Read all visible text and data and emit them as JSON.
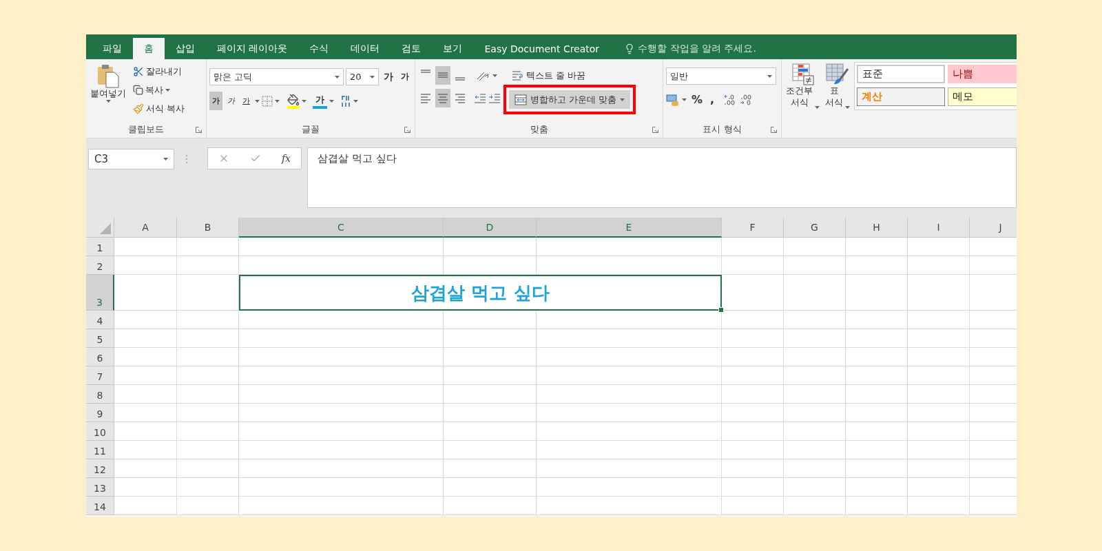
{
  "tabs": [
    {
      "label": "파일",
      "selected": false
    },
    {
      "label": "홈",
      "selected": true
    },
    {
      "label": "삽입",
      "selected": false
    },
    {
      "label": "페이지 레이아웃",
      "selected": false
    },
    {
      "label": "수식",
      "selected": false
    },
    {
      "label": "데이터",
      "selected": false
    },
    {
      "label": "검토",
      "selected": false
    },
    {
      "label": "보기",
      "selected": false
    },
    {
      "label": "Easy Document Creator",
      "selected": false
    }
  ],
  "tell_me": {
    "placeholder": "수행할 작업을 알려 주세요."
  },
  "clipboard": {
    "title": "클립보드",
    "paste": "붙여넣기",
    "cut": "잘라내기",
    "copy": "복사",
    "format_painter": "서식 복사"
  },
  "font": {
    "title": "글꼴",
    "font_name": "맑은 고딕",
    "font_size": "20",
    "grow": "가",
    "shrink": "가",
    "styles": [
      {
        "kind": "bold",
        "label": "가",
        "selected": true
      },
      {
        "kind": "italic",
        "label": "가",
        "selected": false
      },
      {
        "kind": "underline",
        "label": "가",
        "selected": false
      }
    ],
    "font_color": "가"
  },
  "alignment": {
    "title": "맞춤",
    "vertical": [
      {
        "kind": "top",
        "selected": false
      },
      {
        "kind": "middle",
        "selected": true
      },
      {
        "kind": "bottom",
        "selected": false
      }
    ],
    "horizontal": [
      {
        "kind": "left",
        "selected": false
      },
      {
        "kind": "center",
        "selected": true
      },
      {
        "kind": "right",
        "selected": false
      }
    ],
    "wrap_text": "텍스트 줄 바꿈",
    "merge": {
      "label": "병합하고 가운데 맞춤",
      "highlighted": true
    }
  },
  "number": {
    "title": "표시 형식",
    "format": "일반",
    "percent": "%",
    "comma": ","
  },
  "styles": {
    "conditional_formatting": "조건부\n서식",
    "format_as_table": "표\n서식",
    "cell_styles": [
      {
        "kind": "normal",
        "label": "표준"
      },
      {
        "kind": "bad",
        "label": "나쁨"
      },
      {
        "kind": "calculation",
        "label": "계산"
      },
      {
        "kind": "note",
        "label": "메모"
      }
    ]
  },
  "formula_bar": {
    "name_box": "C3",
    "function_label": "fx",
    "value": "삼겹살 먹고 싶다"
  },
  "sheet": {
    "columns": [
      {
        "label": "A",
        "selected": false
      },
      {
        "label": "B",
        "selected": false
      },
      {
        "label": "C",
        "selected": true
      },
      {
        "label": "D",
        "selected": true
      },
      {
        "label": "E",
        "selected": true
      },
      {
        "label": "F",
        "selected": false
      },
      {
        "label": "G",
        "selected": false
      },
      {
        "label": "H",
        "selected": false
      },
      {
        "label": "I",
        "selected": false
      },
      {
        "label": "J",
        "selected": false
      }
    ],
    "rows": [
      {
        "label": "1",
        "selected": false
      },
      {
        "label": "2",
        "selected": false
      },
      {
        "label": "3",
        "selected": true
      },
      {
        "label": "4",
        "selected": false
      },
      {
        "label": "5",
        "selected": false
      },
      {
        "label": "6",
        "selected": false
      },
      {
        "label": "7",
        "selected": false
      },
      {
        "label": "8",
        "selected": false
      },
      {
        "label": "9",
        "selected": false
      },
      {
        "label": "10",
        "selected": false
      },
      {
        "label": "11",
        "selected": false
      },
      {
        "label": "12",
        "selected": false
      },
      {
        "label": "13",
        "selected": false
      },
      {
        "label": "14",
        "selected": false
      }
    ],
    "active_cell": {
      "text": "삼겹살 먹고 싶다"
    }
  }
}
